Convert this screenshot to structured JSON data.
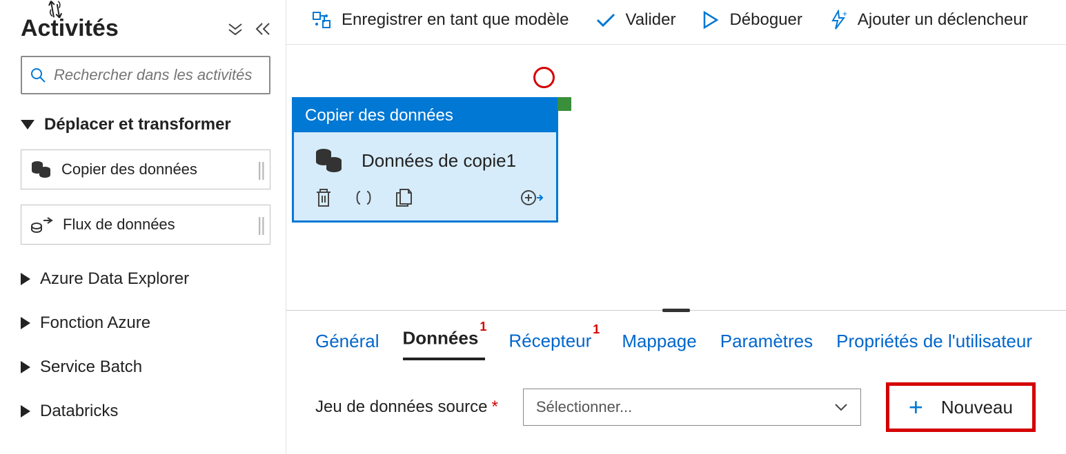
{
  "sidebar": {
    "title": "Activités",
    "search_placeholder": "Rechercher dans les activités",
    "expanded_section": "Déplacer et transformer",
    "activities": [
      {
        "label": "Copier des données"
      },
      {
        "label": "Flux de données"
      }
    ],
    "collapsed_categories": [
      "Azure Data Explorer",
      "Fonction Azure",
      "Service Batch",
      "Databricks"
    ]
  },
  "toolbar": {
    "save_template": "Enregistrer en tant que modèle",
    "validate": "Valider",
    "debug": "Déboguer",
    "add_trigger": "Ajouter un déclencheur"
  },
  "canvas_node": {
    "header": "Copier des données",
    "title": "Données de copie1"
  },
  "tabs": {
    "general": "Général",
    "source": "Données",
    "source_badge": "1",
    "sink": "Récepteur",
    "sink_badge": "1",
    "mapping": "Mappage",
    "settings": "Paramètres",
    "user_props": "Propriétés de l'utilisateur"
  },
  "form": {
    "source_dataset_label": "Jeu de données source",
    "select_placeholder": "Sélectionner...",
    "new_button": "Nouveau"
  }
}
